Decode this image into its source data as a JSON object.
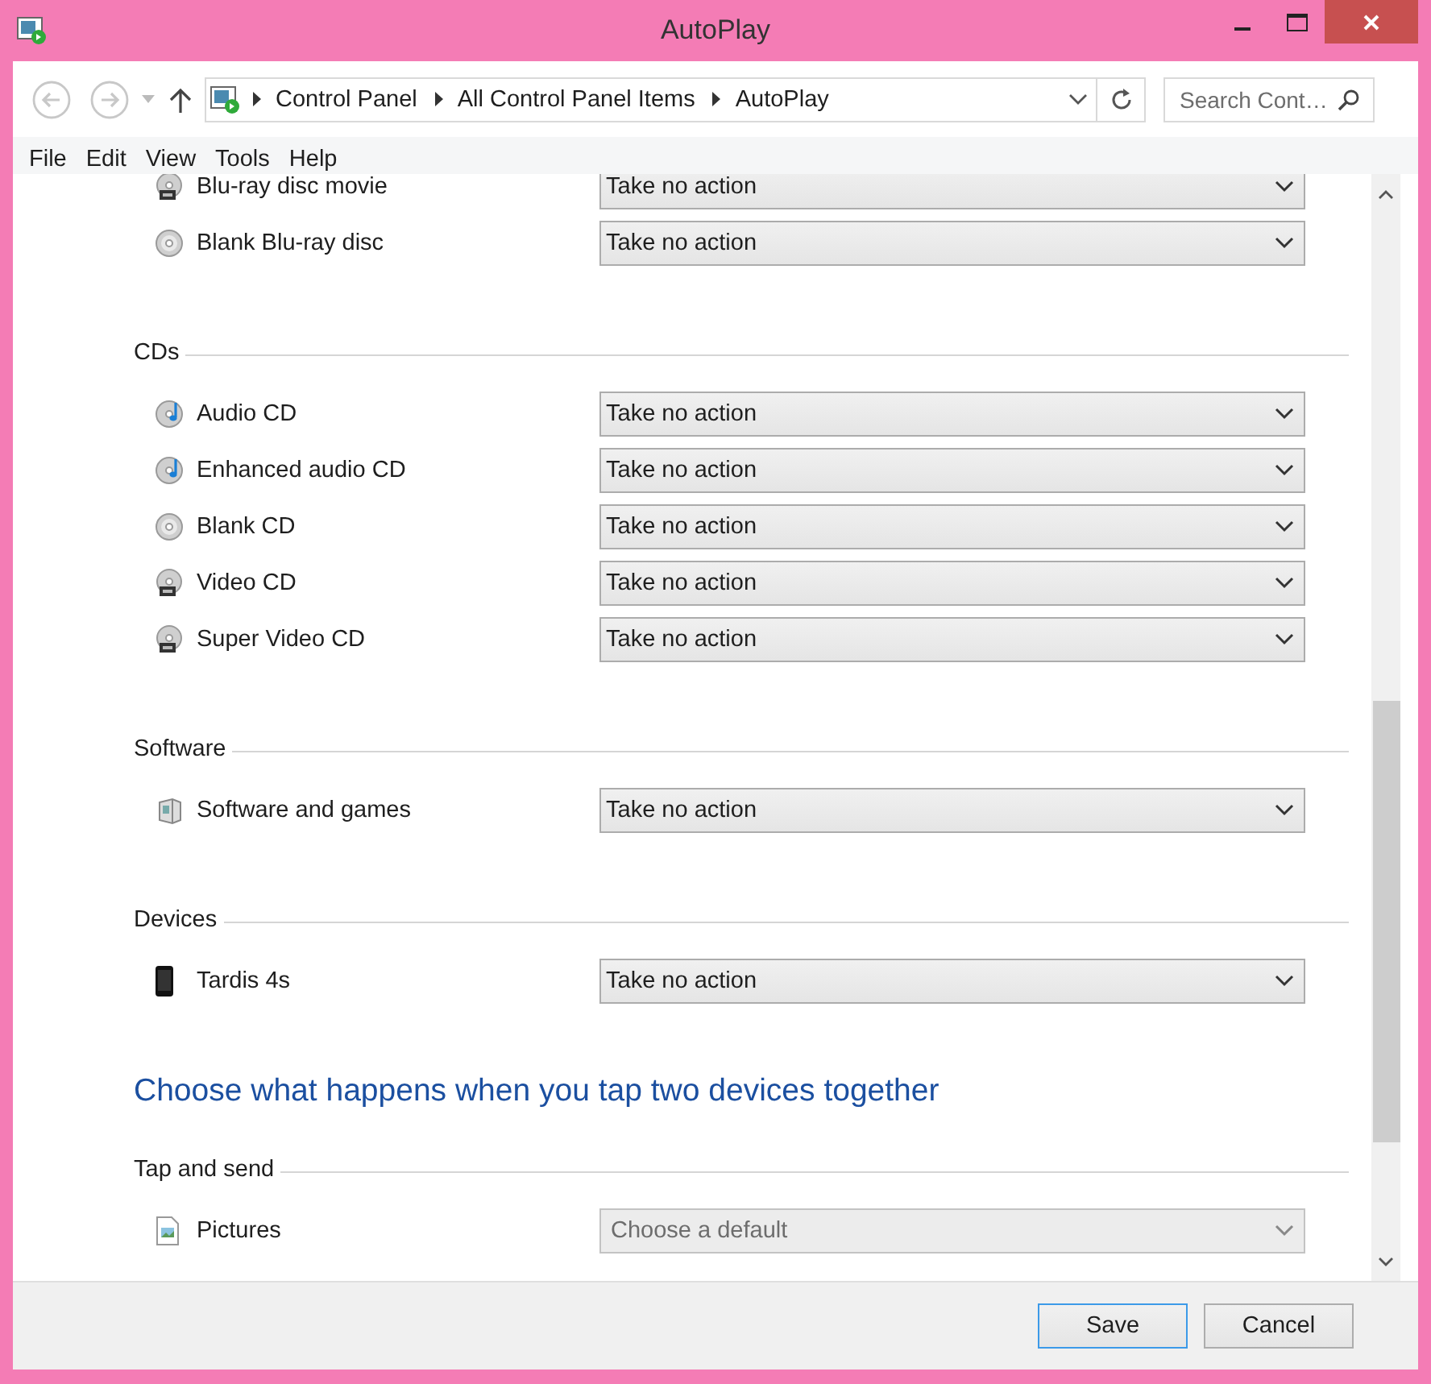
{
  "window": {
    "title": "AutoPlay"
  },
  "address_bar": {
    "breadcrumbs": [
      "Control Panel",
      "All Control Panel Items",
      "AutoPlay"
    ]
  },
  "search": {
    "placeholder": "Search Cont…"
  },
  "menu": [
    "File",
    "Edit",
    "View",
    "Tools",
    "Help"
  ],
  "sections": [
    {
      "kind": "group",
      "items": [
        {
          "label": "Blu-ray disc movie",
          "kind": "video-disc",
          "action": "Take no action",
          "disabled": false
        },
        {
          "label": "Blank Blu-ray disc",
          "kind": "disc",
          "action": "Take no action",
          "disabled": false
        }
      ]
    },
    {
      "kind": "group",
      "heading": "CDs",
      "items": [
        {
          "label": "Audio CD",
          "kind": "audio-disc",
          "action": "Take no action",
          "disabled": false
        },
        {
          "label": "Enhanced audio CD",
          "kind": "audio-disc",
          "action": "Take no action",
          "disabled": false
        },
        {
          "label": "Blank CD",
          "kind": "disc",
          "action": "Take no action",
          "disabled": false
        },
        {
          "label": "Video CD",
          "kind": "video-disc",
          "action": "Take no action",
          "disabled": false
        },
        {
          "label": "Super Video CD",
          "kind": "video-disc",
          "action": "Take no action",
          "disabled": false
        }
      ]
    },
    {
      "kind": "group",
      "heading": "Software",
      "items": [
        {
          "label": "Software and games",
          "kind": "software",
          "action": "Take no action",
          "disabled": false
        }
      ]
    },
    {
      "kind": "group",
      "heading": "Devices",
      "items": [
        {
          "label": "Tardis 4s",
          "kind": "phone",
          "action": "Take no action",
          "disabled": false
        }
      ]
    },
    {
      "kind": "title",
      "text": "Choose what happens when you tap two devices together"
    },
    {
      "kind": "group",
      "heading": "Tap and send",
      "items": [
        {
          "label": "Pictures",
          "kind": "picture",
          "action": "Choose a default",
          "disabled": true
        }
      ]
    }
  ],
  "buttons": [
    {
      "label": "Save",
      "default": true
    },
    {
      "label": "Cancel",
      "default": false
    }
  ]
}
